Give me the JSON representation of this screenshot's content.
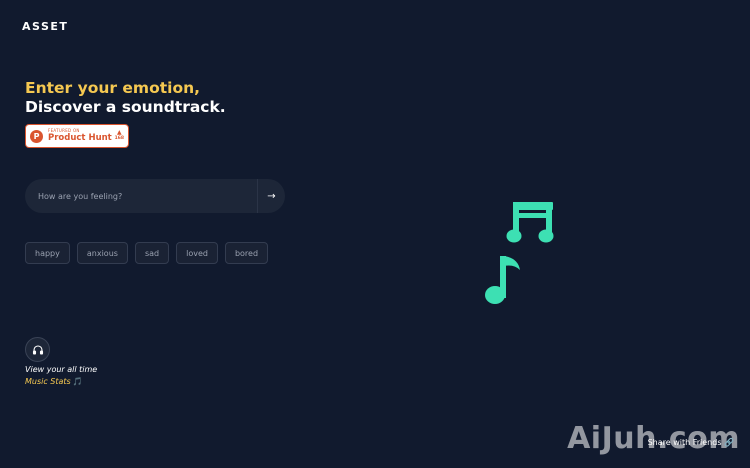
{
  "brand": {
    "logo_text": "ASSET"
  },
  "hero": {
    "line1": "Enter your emotion,",
    "line2": "Discover a soundtrack."
  },
  "product_hunt": {
    "small": "FEATURED ON",
    "big": "Product Hunt",
    "votes": "168",
    "logo_letter": "P",
    "tri": "▲"
  },
  "search": {
    "placeholder": "How are you feeling?",
    "submit_icon": "→"
  },
  "emotions": [
    "happy",
    "anxious",
    "sad",
    "loved",
    "bored"
  ],
  "stats": {
    "line1": "View your all time",
    "line2": "Music Stats",
    "note_icon": "🎵"
  },
  "footer": {
    "share_label": "Share with Friends 🔗"
  },
  "watermark": {
    "text": "AiJuh.com"
  },
  "colors": {
    "background": "#111a2e",
    "accent_yellow": "#f5c851",
    "notes_green": "#3de0b3",
    "ph_orange": "#da552f"
  }
}
